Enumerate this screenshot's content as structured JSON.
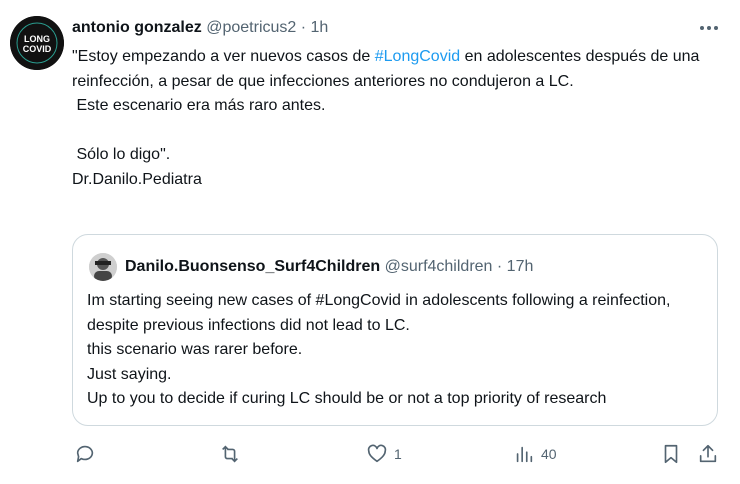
{
  "tweet": {
    "author_name": "antonio gonzalez",
    "handle": "@poetricus2",
    "separator": "·",
    "time": "1h",
    "text_before_hashtag": "\"Estoy empezando a ver nuevos casos de ",
    "hashtag": "#LongCovid",
    "text_after_hashtag": " en adolescentes después de una reinfección, a pesar de que infecciones anteriores no condujeron a LC.\n Este escenario era más raro antes.\n\n Sólo lo digo\".\nDr.Danilo.Pediatra",
    "avatar_text": {
      "line1": "LONG",
      "line2": "COVID"
    }
  },
  "quoted_tweet": {
    "author_name": "Danilo.Buonsenso_Surf4Children",
    "handle": "@surf4children",
    "separator": "·",
    "time": "17h",
    "text": "Im starting seeing new cases of #LongCovid in adolescents following a reinfection, despite previous infections did not lead to LC.\nthis scenario was rarer before.\nJust saying.\nUp to you to decide if curing LC should be or not a top priority of research"
  },
  "actions": {
    "reply_icon": "reply-icon",
    "retweet_icon": "retweet-icon",
    "like_icon": "heart-icon",
    "like_count": "1",
    "views_icon": "views-icon",
    "views_count": "40",
    "bookmark_icon": "bookmark-icon",
    "share_icon": "share-icon"
  },
  "colors": {
    "hashtag": "#1d9bf0",
    "secondary_text": "#536471",
    "border": "#cfd9de"
  }
}
